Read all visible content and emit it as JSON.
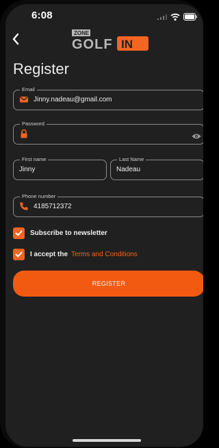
{
  "status_bar": {
    "time": "6:08"
  },
  "header": {
    "logo_small": "ZONE",
    "logo_main": "GOLF",
    "logo_accent": "IN"
  },
  "page": {
    "title": "Register"
  },
  "form": {
    "email": {
      "label": "Email",
      "value": "Jinny.nadeau@gmail.com",
      "icon": "mail-icon"
    },
    "password": {
      "label": "Password",
      "value": "",
      "icon": "lock-icon"
    },
    "first_name": {
      "label": "First name",
      "value": "Jinny"
    },
    "last_name": {
      "label": "Last Name",
      "value": "Nadeau"
    },
    "phone": {
      "label": "Phone number",
      "value": "4185712372",
      "icon": "phone-icon"
    },
    "newsletter": {
      "label": "Subscribe to newsletter",
      "checked": true
    },
    "terms": {
      "label": "I accept the",
      "link": "Terms and Conditions",
      "checked": true
    },
    "submit_label": "REGISTER"
  },
  "colors": {
    "accent": "#f26522",
    "background": "#202020"
  }
}
